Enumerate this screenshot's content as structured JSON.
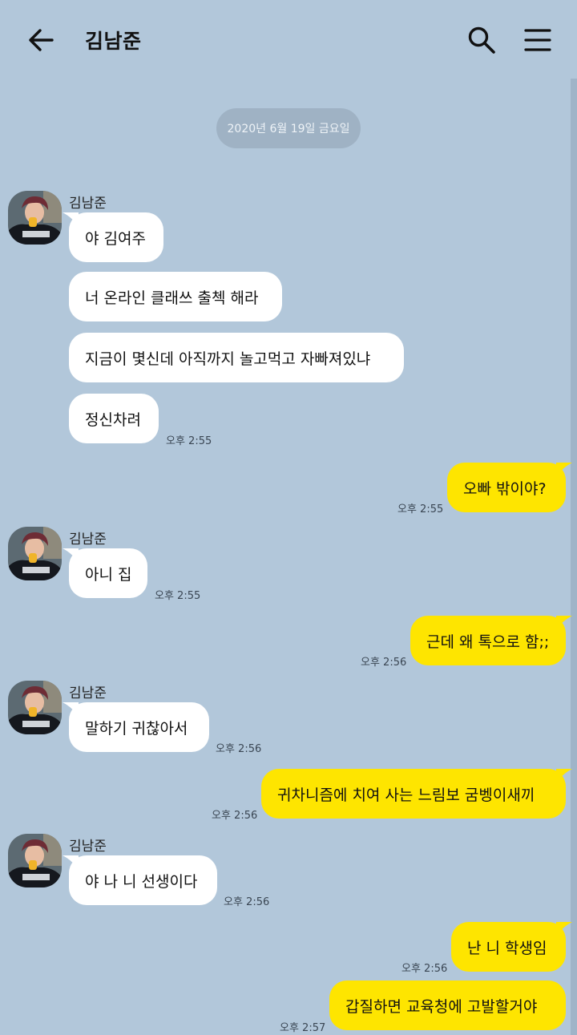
{
  "header": {
    "title": "김남준",
    "back_icon": "back-arrow-icon",
    "search_icon": "search-icon",
    "menu_icon": "menu-icon"
  },
  "date_divider": "2020년 6월 19일 금요일",
  "colors": {
    "background": "#b2c7da",
    "incoming_bubble": "#ffffff",
    "outgoing_bubble": "#fee500"
  },
  "messages": [
    {
      "sender": "김남준",
      "direction": "incoming",
      "text": "야 김여주"
    },
    {
      "direction": "incoming",
      "text": "너 온라인 클래쓰 출첵 해라"
    },
    {
      "direction": "incoming",
      "text": "지금이 몇신데 아직까지 놀고먹고 자빠져있냐"
    },
    {
      "direction": "incoming",
      "text": "정신차려",
      "time": "오후 2:55"
    },
    {
      "direction": "outgoing",
      "text": "오빠 밖이야?",
      "time": "오후 2:55"
    },
    {
      "sender": "김남준",
      "direction": "incoming",
      "text": "아니 집",
      "time": "오후 2:55"
    },
    {
      "direction": "outgoing",
      "text": "근데 왜 톡으로 함;;",
      "time": "오후 2:56"
    },
    {
      "sender": "김남준",
      "direction": "incoming",
      "text": "말하기 귀찮아서",
      "time": "오후 2:56"
    },
    {
      "direction": "outgoing",
      "text": "귀차니즘에 치여 사는 느림보 굼벵이새끼",
      "time": "오후 2:56"
    },
    {
      "sender": "김남준",
      "direction": "incoming",
      "text": "야 나 니 선생이다",
      "time": "오후 2:56"
    },
    {
      "direction": "outgoing",
      "text": "난 니 학생임",
      "time": "오후 2:56"
    },
    {
      "direction": "outgoing",
      "text": "갑질하면 교육청에 고발할거야",
      "time": "오후 2:57"
    }
  ]
}
